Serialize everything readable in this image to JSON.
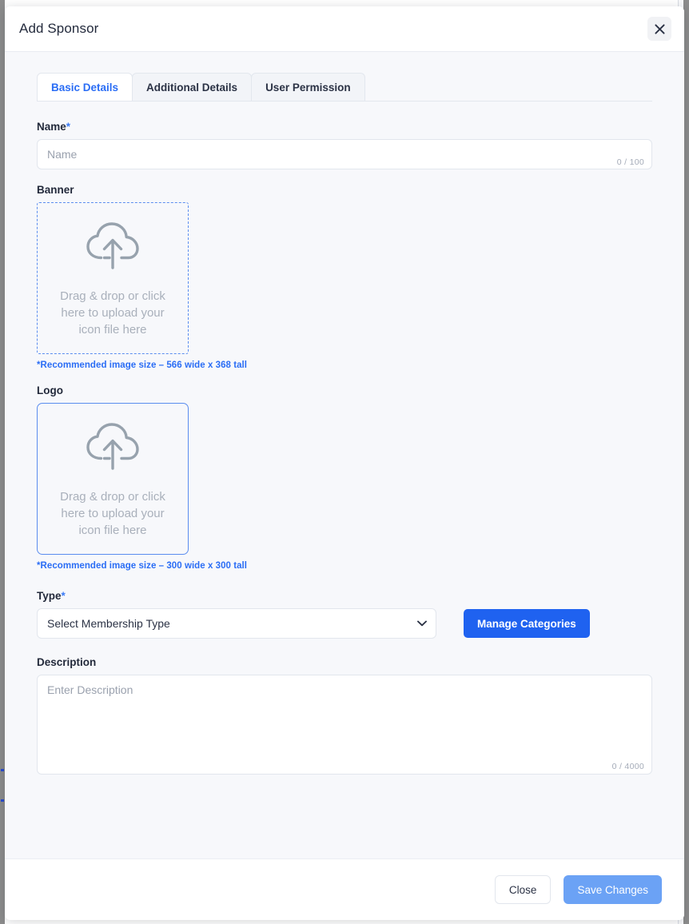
{
  "modal": {
    "title": "Add Sponsor",
    "close_icon": "close-icon"
  },
  "tabs": [
    {
      "label": "Basic Details",
      "active": true
    },
    {
      "label": "Additional Details",
      "active": false
    },
    {
      "label": "User Permission",
      "active": false
    }
  ],
  "form": {
    "name": {
      "label": "Name",
      "required_mark": "*",
      "placeholder": "Name",
      "value": "",
      "counter": "0 / 100"
    },
    "banner": {
      "label": "Banner",
      "dropzone_text": "Drag & drop or click here to upload your icon file here",
      "icon": "cloud-upload-icon",
      "recommendation": "*Recommended image size – 566 wide x 368 tall"
    },
    "logo": {
      "label": "Logo",
      "dropzone_text": "Drag & drop or click here to upload your icon file here",
      "icon": "cloud-upload-icon",
      "recommendation": "*Recommended image size – 300 wide x 300 tall"
    },
    "type": {
      "label": "Type",
      "required_mark": "*",
      "selected_option": "Select Membership Type",
      "manage_button": "Manage Categories"
    },
    "description": {
      "label": "Description",
      "placeholder": "Enter Description",
      "value": "",
      "counter": "0 / 4000"
    }
  },
  "footer": {
    "close_label": "Close",
    "save_label": "Save Changes"
  },
  "colors": {
    "accent_blue": "#1f62f0",
    "link_blue": "#2a6df5",
    "save_blue": "#6ba2f5",
    "body_bg": "#f7f8fb",
    "placeholder": "#9aa1ae"
  }
}
